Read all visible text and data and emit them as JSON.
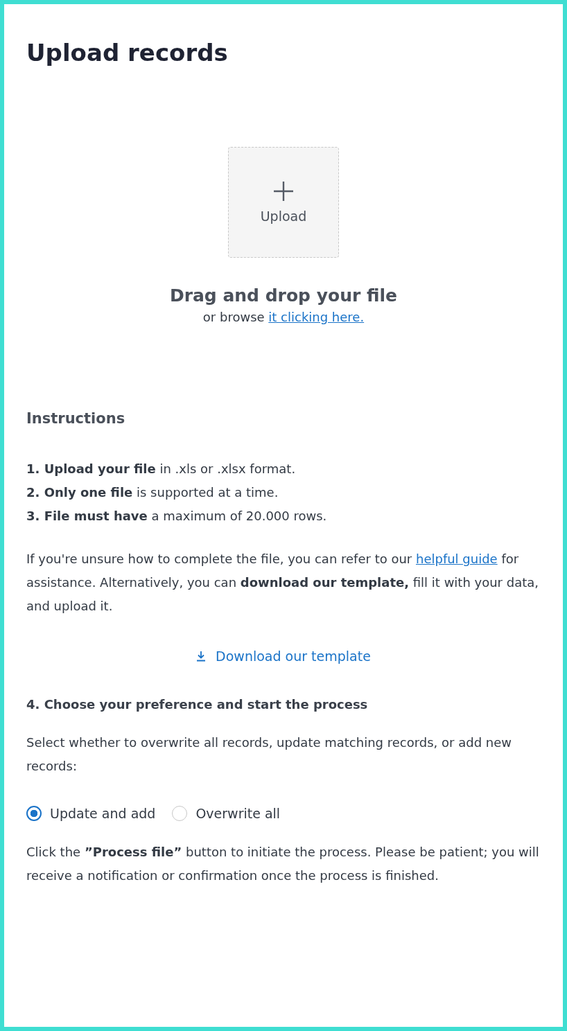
{
  "title": "Upload records",
  "upload": {
    "label": "Upload"
  },
  "dropzone": {
    "heading": "Drag and drop your file",
    "prefix": "or browse ",
    "link": "it clicking here."
  },
  "instructions": {
    "heading": "Instructions",
    "steps": [
      "**1. Upload your file** in .xls or .xlsx format.",
      "**2. Only one file** is supported at a time.",
      "**3. File must have** a maximum of 20.000 rows."
    ]
  },
  "help": {
    "before": "If you're unsure how to complete the file, you can refer to our ",
    "link": "helpful guide",
    "after": " for assistance. Alternatively, you can **download our template,** fill it with your data, and upload it."
  },
  "download": {
    "label": "Download our template"
  },
  "preference": {
    "heading": "4. Choose your preference and start the process",
    "text": "Select whether to overwrite all records, update matching records, or add new records:",
    "options": [
      {
        "label": "Update and add",
        "selected": true
      },
      {
        "label": "Overwrite all",
        "selected": false
      }
    ]
  },
  "note": "Click the **”Process file”** button to initiate the process. Please be patient; you will receive a notification or confirmation once the process is finished."
}
